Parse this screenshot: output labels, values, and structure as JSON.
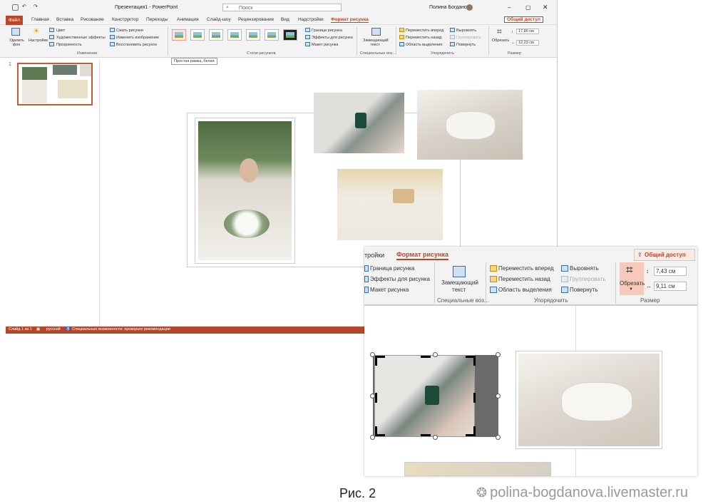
{
  "titlebar": {
    "doc_title": "Презентация1 - PowerPoint",
    "search_placeholder": "Поиск",
    "user": "Полина Богданова"
  },
  "tabs": [
    "Файл",
    "Главная",
    "Вставка",
    "Рисование",
    "Конструктор",
    "Переходы",
    "Анимация",
    "Слайд-шоу",
    "Рецензирование",
    "Вид",
    "Надстройки",
    "Формат рисунка"
  ],
  "share": "Общий доступ",
  "ribbon": {
    "remove_bg": "Удалить фон",
    "corrections": "Настройки",
    "color": "Цвет",
    "artistic": "Художественные эффекты",
    "transparency": "Прозрачность",
    "compress": "Сжать рисунки",
    "change": "Изменить изображение",
    "reset": "Восстановить рисунок",
    "group_adjust": "Изменение",
    "group_styles": "Стили рисунков",
    "border": "Граница рисунка",
    "effects": "Эффекты для рисунка",
    "layout": "Макет рисунка",
    "alt_text": "Замещающий текст",
    "group_access": "Специальные воз...",
    "bring_forward": "Переместить вперед",
    "send_backward": "Переместить назад",
    "selection_pane": "Область выделения",
    "align": "Выровнять",
    "group": "Группировать",
    "rotate": "Повернуть",
    "group_arrange": "Упорядочить",
    "crop": "Обрезать",
    "height": "17,86 см",
    "width": "12,23 см",
    "group_size": "Размер",
    "tooltip": "Простая рамка, белая"
  },
  "slides": {
    "num": "1"
  },
  "status": {
    "slide": "Слайд 1 из 1",
    "lang": "русский",
    "access": "Специальные возможности: проверьте рекомендации"
  },
  "zoom": {
    "tab_prev": "тройки",
    "tab_active": "Формат рисунка",
    "share": "Общий доступ",
    "border": "Граница рисунка",
    "effects": "Эффекты для рисунка",
    "layout": "Макет рисунка",
    "alt_text_1": "Замещающий",
    "alt_text_2": "текст",
    "group_access": "Специальные воз...",
    "bring_forward": "Переместить вперед",
    "send_backward": "Переместить назад",
    "selection_pane": "Область выделения",
    "align": "Выровнять",
    "group": "Группировать",
    "rotate": "Повернуть",
    "group_arrange": "Упорядочить",
    "crop": "Обрезать",
    "height": "7,43 см",
    "width": "9,11 см",
    "group_size": "Размер"
  },
  "caption": "Рис. 2",
  "watermark": "polina-bogdanova.livemaster.ru",
  "colors": {
    "accent": "#b7472a"
  }
}
